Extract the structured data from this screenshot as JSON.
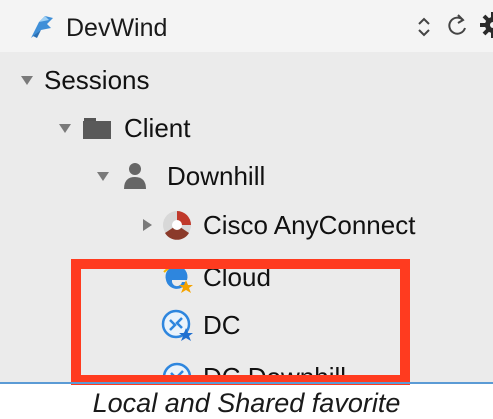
{
  "toolbar": {
    "app_name": "DevWind",
    "app_icon": "devwind-logo-icon",
    "actions": [
      {
        "name": "sort-updown-icon"
      },
      {
        "name": "refresh-icon"
      },
      {
        "name": "gear-icon"
      }
    ]
  },
  "tree": {
    "sessions": {
      "label": "Sessions",
      "expanded": true
    },
    "client": {
      "label": "Client",
      "icon": "folder-icon",
      "expanded": true
    },
    "downhill": {
      "label": "Downhill",
      "icon": "user-icon",
      "expanded": true
    },
    "items": [
      {
        "label": "Cisco AnyConnect",
        "icon": "cisco-anyconnect-icon",
        "expanded": false
      },
      {
        "label": "Cloud",
        "icon": "ie-favorite-icon"
      },
      {
        "label": "DC",
        "icon": "remote-desktop-favorite-icon"
      },
      {
        "label": "DC Downhill",
        "icon": "remote-desktop-icon"
      }
    ]
  },
  "highlight": {
    "color": "#ff3b1f",
    "covers": [
      "Cloud",
      "DC"
    ]
  },
  "colors": {
    "toolbar_bg": "#f4f4f4",
    "tree_bg": "#ebebeb",
    "highlight": "#ff3b1f",
    "divider": "#5b9bd5"
  },
  "caption": "Local and Shared favorite"
}
